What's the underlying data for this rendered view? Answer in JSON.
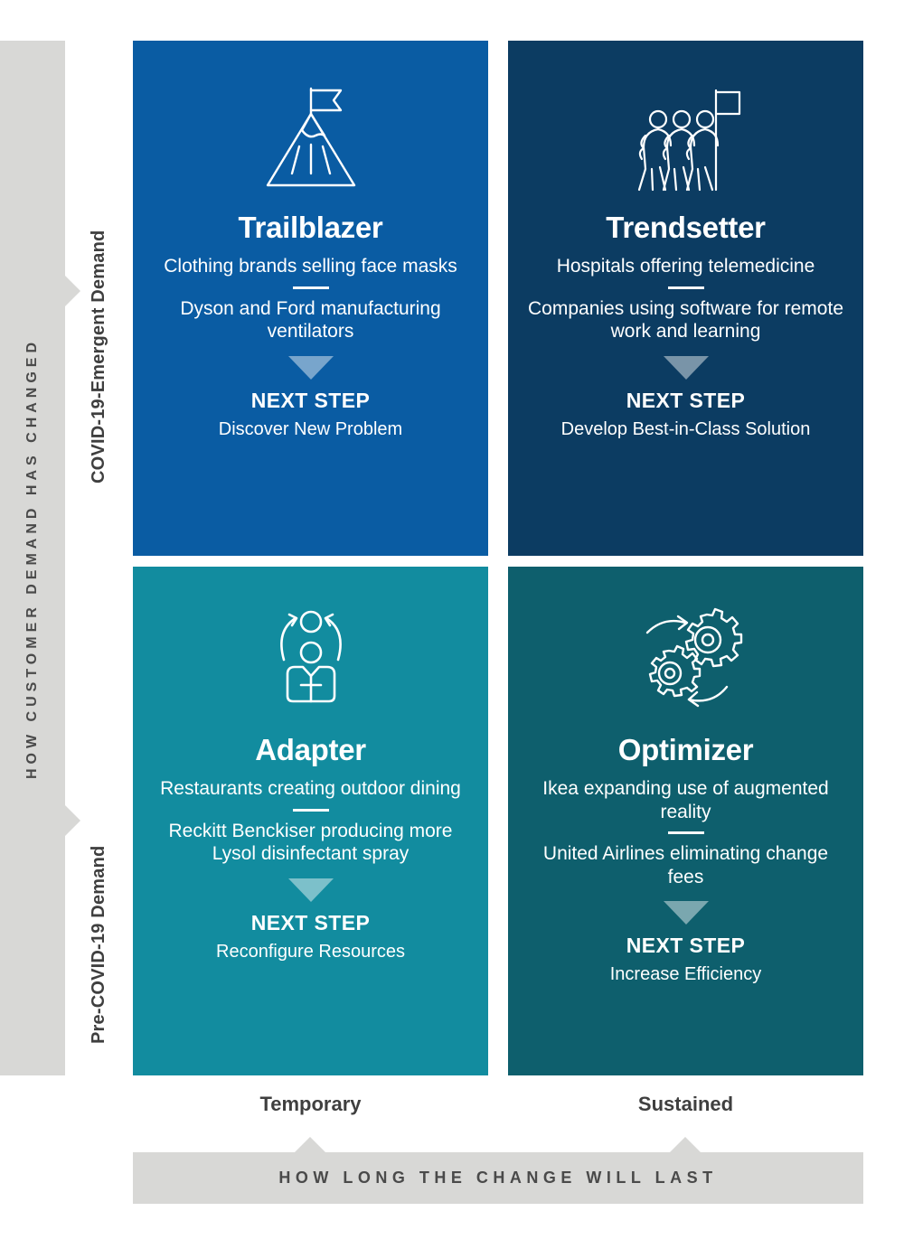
{
  "axes": {
    "y_axis_label": "HOW CUSTOMER DEMAND HAS CHANGED",
    "x_axis_label": "HOW LONG THE CHANGE WILL LAST",
    "row_labels": [
      "COVID-19-Emergent Demand",
      "Pre-COVID-19 Demand"
    ],
    "column_labels": [
      "Temporary",
      "Sustained"
    ]
  },
  "next_step_heading": "NEXT STEP",
  "colors": {
    "trailblazer": "#0a5ca3",
    "trendsetter": "#0c3c62",
    "adapter": "#128c9f",
    "optimizer": "#0e5f6d",
    "axis_gray": "#d8d8d6",
    "axis_text": "#4a4a4a",
    "arrow_fill": "#8fb6cf"
  },
  "quadrants": [
    {
      "id": "trailblazer",
      "icon": "mountain-flag-icon",
      "title": "Trailblazer",
      "examples": [
        "Clothing brands selling face masks",
        "Dyson and Ford manufacturing ventilators"
      ],
      "next_step": "Discover New Problem"
    },
    {
      "id": "trendsetter",
      "icon": "marching-people-flag-icon",
      "title": "Trendsetter",
      "examples": [
        "Hospitals offering telemedicine",
        "Companies using software for remote work and learning"
      ],
      "next_step": "Develop Best-in-Class Solution"
    },
    {
      "id": "adapter",
      "icon": "person-rotating-arrows-icon",
      "title": "Adapter",
      "examples": [
        "Restaurants creating outdoor dining",
        "Reckitt Benckiser producing more Lysol disinfectant spray"
      ],
      "next_step": "Reconfigure Resources"
    },
    {
      "id": "optimizer",
      "icon": "gears-cycle-icon",
      "title": "Optimizer",
      "examples": [
        "Ikea expanding use of augmented reality",
        "United Airlines eliminating change fees"
      ],
      "next_step": "Increase Efficiency"
    }
  ]
}
